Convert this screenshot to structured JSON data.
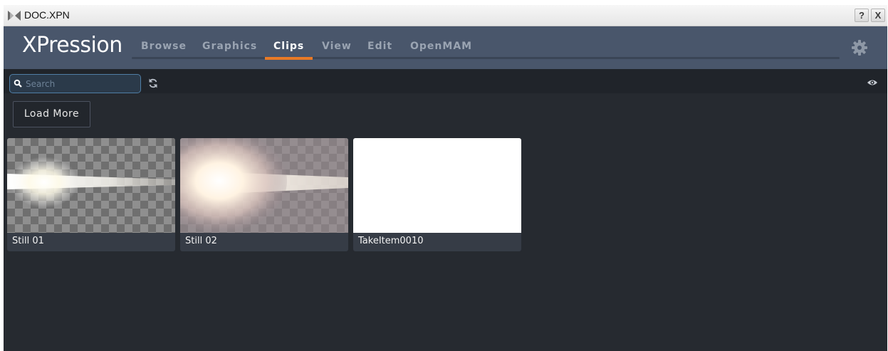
{
  "window": {
    "title": "DOC.XPN",
    "help_label": "?",
    "close_label": "X"
  },
  "app": {
    "brand": "XPression",
    "accent_color": "#e97a26",
    "nav": [
      {
        "label": "Browse",
        "active": false
      },
      {
        "label": "Graphics",
        "active": false
      },
      {
        "label": "Clips",
        "active": true
      },
      {
        "label": "View",
        "active": false
      },
      {
        "label": "Edit",
        "active": false
      },
      {
        "label": "OpenMAM",
        "active": false
      }
    ],
    "settings_icon": "gear-icon"
  },
  "toolbar": {
    "search_placeholder": "Search",
    "search_value": "",
    "refresh_icon": "refresh-icon",
    "visibility_icon": "eye-icon"
  },
  "main": {
    "load_more_label": "Load More",
    "clips": [
      {
        "name": "Still 01",
        "thumbnail": "lens-flare-on-transparency"
      },
      {
        "name": "Still 02",
        "thumbnail": "bright-flare-on-transparency"
      },
      {
        "name": "TakeItem0010",
        "thumbnail": "white-frame"
      }
    ]
  }
}
